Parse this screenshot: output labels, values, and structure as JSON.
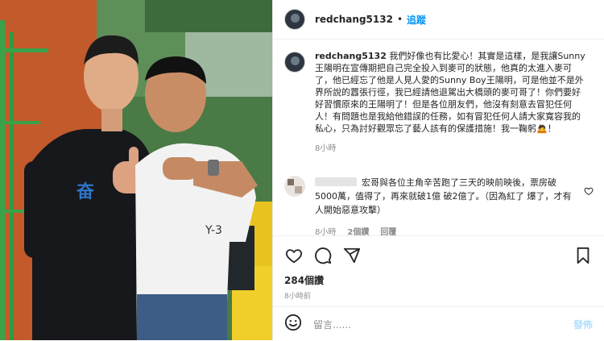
{
  "header": {
    "username": "redchang5132",
    "separator": "•",
    "follow_label": "追蹤"
  },
  "caption": {
    "username": "redchang5132",
    "text": "我們好像也有比愛心！其實是這樣，是我讓Sunny王陽明在宣傳期把自己完全投入到麥可的狀態，他真的太進入麥可了，他已經忘了他是人見人愛的Sunny Boy王陽明，可是他並不是外界所說的囂張行徑，我已經請他退駕出大橋頭的麥可哥了！你們要好好習慣原來的王陽明了！但是各位朋友們，他沒有刻意去冒犯任何人！有問題也是我給他錯誤的任務，如有冒犯任何人請大家寬容我的私心，只為討好觀眾忘了藝人該有的保護措施！我一鞠躬🙇！",
    "time": "8小時"
  },
  "comment": {
    "text": "宏哥與各位主角辛苦跑了三天的映前映後，票房破5000萬，值得了，再來就破1億 破2億了。（因為紅了 爆了，才有人開始惡意攻擊）",
    "time": "8小時",
    "likes": "2個讚",
    "reply_label": "回覆"
  },
  "actions": {
    "like_icon": "heart-icon",
    "comment_icon": "comment-icon",
    "share_icon": "share-icon",
    "save_icon": "bookmark-icon"
  },
  "likes_count": "284個讚",
  "post_time": "8小時前",
  "add_comment": {
    "placeholder": "留言......",
    "post_label": "發佈"
  },
  "colors": {
    "accent": "#0095f6",
    "text": "#262626",
    "muted": "#8e8e8e",
    "post_disabled": "#b2dffc"
  }
}
